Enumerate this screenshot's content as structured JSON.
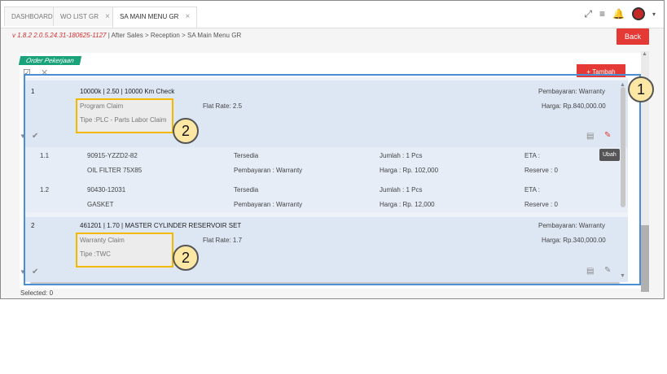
{
  "tabs": [
    {
      "label": "DASHBOARD"
    },
    {
      "label": "WO LIST GR",
      "close": "×"
    },
    {
      "label": "SA MAIN MENU GR",
      "close": "×"
    }
  ],
  "breadcrumb": {
    "version": "v 1.8.2 2.0.5.24.31-180625-1127",
    "path": "| After Sales > Reception > SA Main Menu GR"
  },
  "back_label": "Back",
  "section_label": "Order Pekerjaan",
  "tambah_label": "+ Tambah",
  "jobs": [
    {
      "no": "1",
      "title": "10000k | 2.50 | 10000 Km Check",
      "claim": "Program Claim",
      "tipe": "Tipe :PLC - Parts Labor Claim",
      "flat_rate": "Flat Rate: 2.5",
      "pembayaran": "Pembayaran: Warranty",
      "harga": "Harga: Rp.840,000.00",
      "parts": [
        {
          "no": "1.1",
          "code": "90915-YZZD2-82",
          "name": "OIL FILTER 75X85",
          "status": "Tersedia",
          "bayar": "Pembayaran : Warranty",
          "jumlah": "Jumlah : 1 Pcs",
          "harga": "Harga : Rp. 102,000",
          "eta": "ETA :",
          "reserve": "Reserve : 0"
        },
        {
          "no": "1.2",
          "code": "90430-12031",
          "name": "GASKET",
          "status": "Tersedia",
          "bayar": "Pembayaran : Warranty",
          "jumlah": "Jumlah : 1 Pcs",
          "harga": "Harga : Rp. 12,000",
          "eta": "ETA :",
          "reserve": "Reserve : 0"
        }
      ]
    },
    {
      "no": "2",
      "title": "461201 | 1.70 | MASTER CYLINDER RESERVOIR SET",
      "claim": "Warranty Claim",
      "tipe": "Tipe :TWC",
      "flat_rate": "Flat Rate: 1.7",
      "pembayaran": "Pembayaran: Warranty",
      "harga": "Harga: Rp.340,000.00"
    }
  ],
  "tooltip": "Ubah",
  "footer": "Selected: 0",
  "annotations": {
    "one": "1",
    "two": "2"
  }
}
